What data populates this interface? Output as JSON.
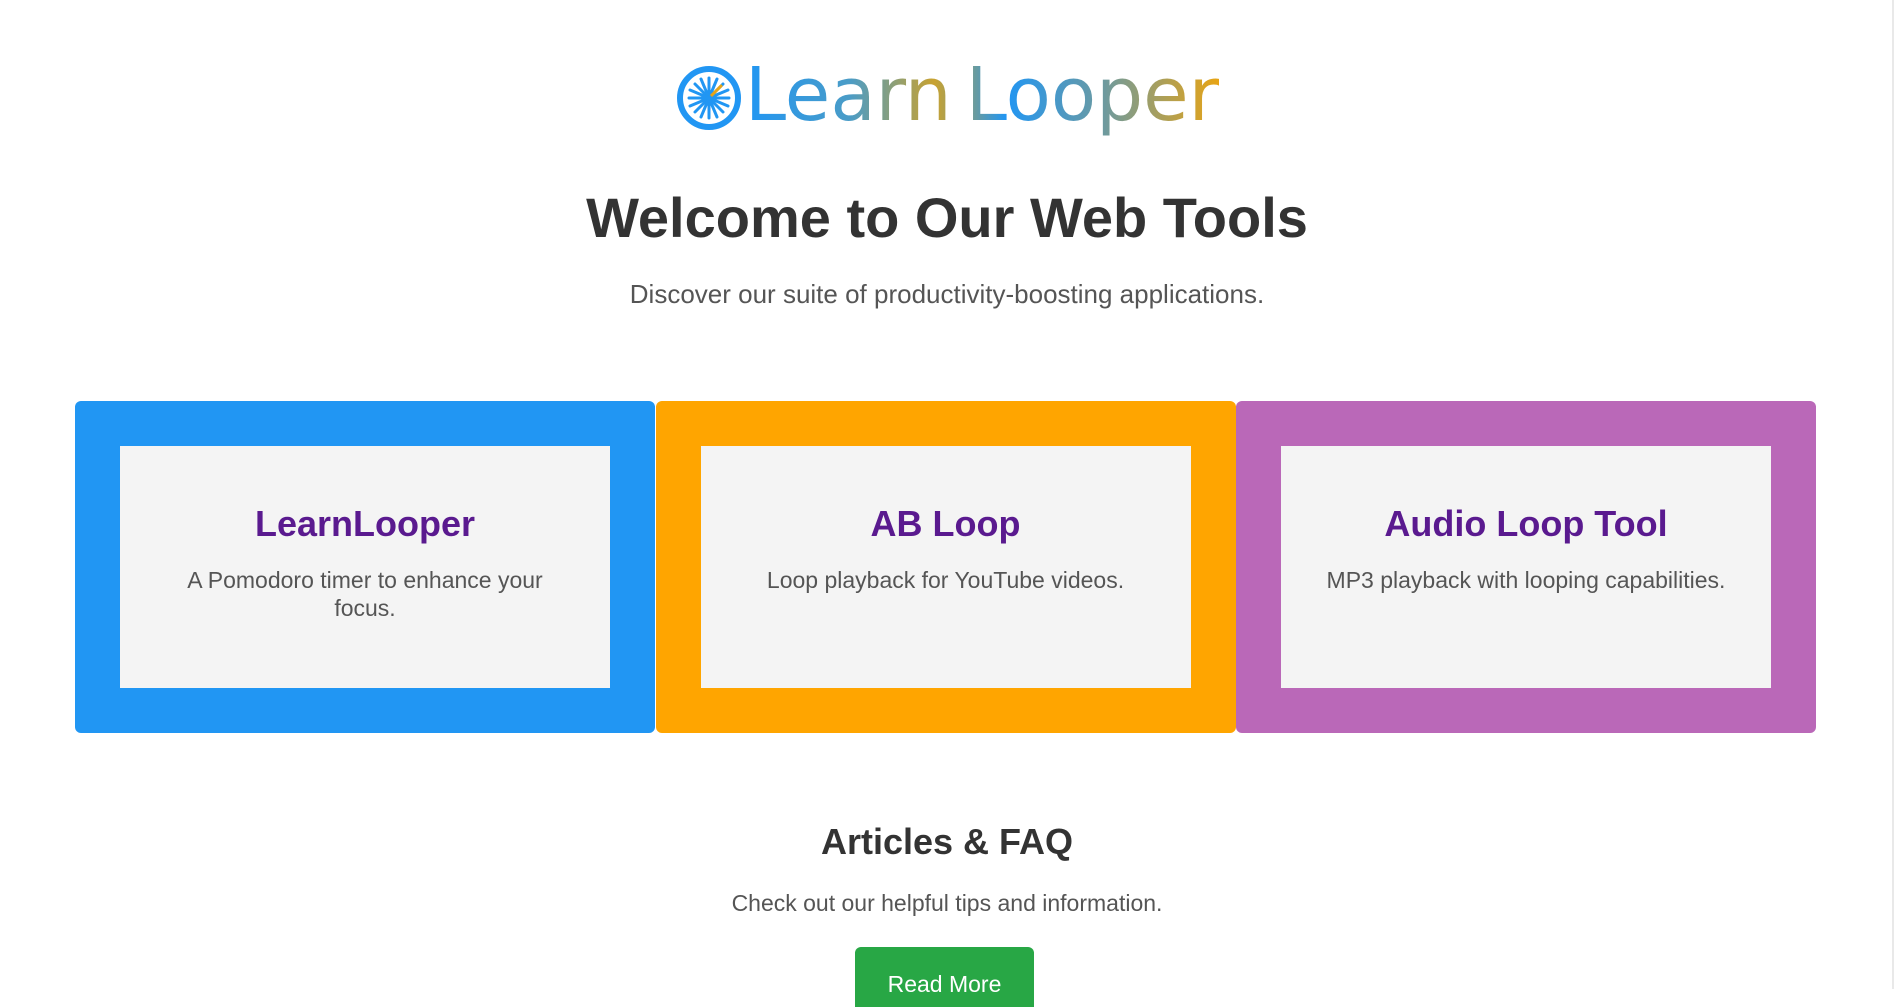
{
  "header": {
    "logo_word1": "Learn",
    "logo_word2": "Looper"
  },
  "hero": {
    "title": "Welcome to Our Web Tools",
    "subtitle": "Discover our suite of productivity-boosting applications."
  },
  "tools": [
    {
      "title": "LearnLooper",
      "description": "A Pomodoro timer to enhance your focus.",
      "color": "#2196f3"
    },
    {
      "title": "AB Loop",
      "description": "Loop playback for YouTube videos.",
      "color": "#ffa500"
    },
    {
      "title": "Audio Loop Tool",
      "description": "MP3 playback with looping capabilities.",
      "color": "#ba68b8"
    }
  ],
  "articles": {
    "title": "Articles & FAQ",
    "subtitle": "Check out our helpful tips and information.",
    "button_label": "Read More",
    "button_color": "#28a745"
  },
  "colors": {
    "tool_title": "#5a1a8f",
    "tool_inner_bg": "#f4f4f4",
    "logo_icon": "#2196f3",
    "logo_icon_accent": "#e8a414"
  },
  "icons": {
    "logo": "sunburst-loop-icon"
  }
}
